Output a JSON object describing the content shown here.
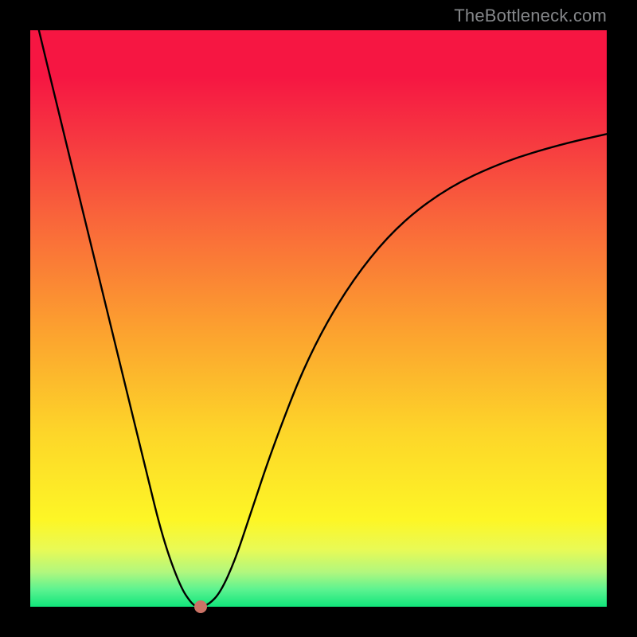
{
  "watermark": "TheBottleneck.com",
  "chart_data": {
    "type": "line",
    "title": "",
    "xlabel": "",
    "ylabel": "",
    "xlim": [
      0,
      1
    ],
    "ylim": [
      0,
      1
    ],
    "series": [
      {
        "name": "curve",
        "x": [
          0.015,
          0.05,
          0.1,
          0.15,
          0.2,
          0.23,
          0.26,
          0.28,
          0.29,
          0.295,
          0.31,
          0.33,
          0.355,
          0.38,
          0.42,
          0.48,
          0.55,
          0.63,
          0.72,
          0.82,
          0.92,
          1.0
        ],
        "y": [
          1.0,
          0.855,
          0.65,
          0.445,
          0.24,
          0.118,
          0.035,
          0.005,
          0.0,
          0.0,
          0.004,
          0.025,
          0.08,
          0.155,
          0.275,
          0.43,
          0.555,
          0.655,
          0.725,
          0.772,
          0.802,
          0.82
        ]
      }
    ],
    "annotations": {
      "marker": {
        "x": 0.295,
        "y": 0.0,
        "color": "#cb7366"
      }
    },
    "background": {
      "type": "vertical-gradient",
      "stops": [
        {
          "pos": 0.0,
          "color": "#f61642"
        },
        {
          "pos": 0.5,
          "color": "#fca12f"
        },
        {
          "pos": 0.85,
          "color": "#fdf626"
        },
        {
          "pos": 1.0,
          "color": "#11e57b"
        }
      ]
    }
  }
}
